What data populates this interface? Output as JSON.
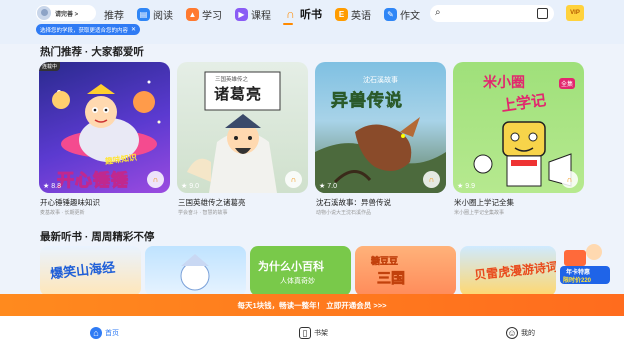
{
  "header": {
    "profile_label": "请完善 >",
    "tabs": [
      {
        "label": "推荐",
        "icon": "none"
      },
      {
        "label": "阅读",
        "icon": "book-icon",
        "color": "#2f86f6"
      },
      {
        "label": "学习",
        "icon": "graduation-cap-icon",
        "color": "#ff7a30"
      },
      {
        "label": "课程",
        "icon": "course-icon",
        "color": "#8a5cf5"
      },
      {
        "label": "听书",
        "icon": "headphones-icon",
        "color": "#ff8a00",
        "active": true
      },
      {
        "label": "英语",
        "icon": "english-icon",
        "color": "#ff9c00"
      },
      {
        "label": "作文",
        "icon": "composition-icon",
        "color": "#2f86f6"
      }
    ],
    "vip_label": "VIP",
    "tip_pill": "选择您的学段，获取更适合您的内容"
  },
  "sections": {
    "hot_title": "热门推荐 · 大家都爱听",
    "new_title": "最新听书 · 周周精彩不停"
  },
  "hot_cards": [
    {
      "cover_title": "开心锤锤",
      "cover_tag": "趣味知识",
      "badge": "连载中",
      "rating": "8.8",
      "title": "开心锤锤趣味知识",
      "sub": "麦基故事 · 长期更新"
    },
    {
      "cover_title": "诸葛亮",
      "cover_tag": "三国英雄传之",
      "rating": "9.0",
      "title": "三国英雄传之诸葛亮",
      "sub": "学会奋斗 · 智慧的故事"
    },
    {
      "cover_title": "异兽传说",
      "cover_tag": "沈石溪故事",
      "rating": "7.0",
      "title": "沈石溪故事：异兽传说",
      "sub": "动物小说大王沈石溪作品"
    },
    {
      "cover_title": "上学记",
      "cover_tag": "米小圈",
      "cover_tag2": "全集",
      "rating": "9.9",
      "title": "米小圈上学记全集",
      "sub": "米小圈上学记全集故事"
    }
  ],
  "new_cards": [
    {
      "title": "爆笑山海经"
    },
    {
      "title": ""
    },
    {
      "title": "为什么小百科",
      "sub": "人体真奇妙"
    },
    {
      "title": "三国",
      "tag": "糖豆豆"
    },
    {
      "title": "贝雷虎漫游诗词"
    }
  ],
  "promo": {
    "line1": "年卡特惠",
    "line2": "限时价220"
  },
  "banner": "每天1块钱，畅读一整年！ 立即开通会员 >>>",
  "bottom_nav": [
    {
      "label": "首页",
      "icon": "home-icon",
      "active": true
    },
    {
      "label": "书架",
      "icon": "bookshelf-icon"
    },
    {
      "label": "我的",
      "icon": "profile-icon"
    }
  ],
  "colors": {
    "accent": "#ff8a00",
    "blue": "#2f7bf4",
    "banner": "#ff7a1e"
  }
}
